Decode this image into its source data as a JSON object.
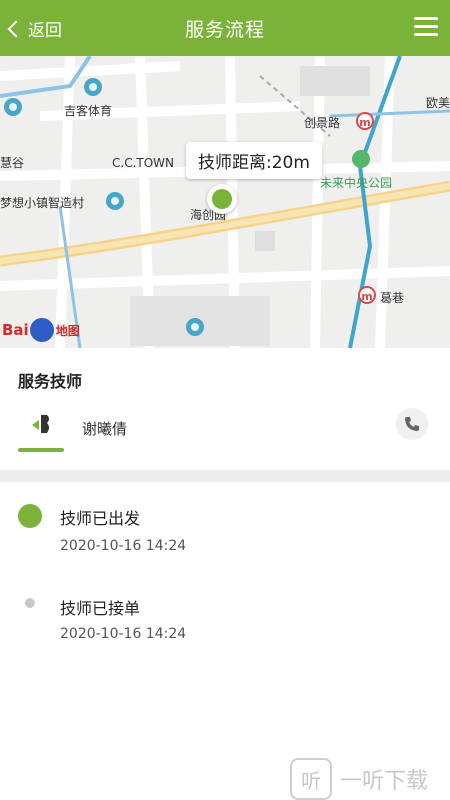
{
  "header": {
    "back_label": "返回",
    "title": "服务流程"
  },
  "map": {
    "distance_label": "技师距离:20m",
    "labels": {
      "sports": "吉客体育",
      "ctown": "C.C.TOWN",
      "chuangjing_road": "创景路",
      "gu": "慧谷",
      "dream_town": "梦想小镇智造村",
      "park": "未来中央公园",
      "haichuang": "海创园",
      "gehang": "葛巷",
      "ou": "欧美"
    },
    "baidu_logo": {
      "bai": "Bai",
      "du": "du",
      "map": "地图"
    }
  },
  "technician": {
    "section_title": "服务技师",
    "name": "谢曦倩"
  },
  "steps": [
    {
      "title": "技师已出发",
      "time": "2020-10-16 14:24",
      "active": true
    },
    {
      "title": "技师已接单",
      "time": "2020-10-16 14:24",
      "active": false
    }
  ],
  "watermark": {
    "icon_text": "听",
    "text": "一听下载"
  },
  "colors": {
    "brand_green": "#7bb33a",
    "inactive_dot": "#c8c8c8",
    "metro_red": "#d84b4b"
  }
}
